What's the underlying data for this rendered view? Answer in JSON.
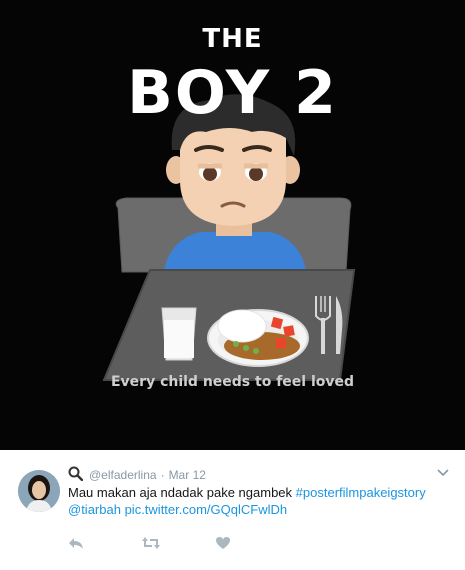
{
  "poster": {
    "title_line1": "THE",
    "title_line2": "BOY 2",
    "tagline": "Every child needs to feel loved"
  },
  "tweet": {
    "handle": "@elfaderlina",
    "separator": "·",
    "date": "Mar 12",
    "text_plain": "Mau makan aja ndadak pake ngambek ",
    "hashtag": "#posterfilmpakeigstory",
    "mention": "@tiarbah",
    "pic_link": "pic.twitter.com/GQqlCFwlDh"
  },
  "icons": {
    "verified_like": "magnifier-icon",
    "more": "chevron-down-icon",
    "reply": "reply-icon",
    "retweet": "retweet-icon",
    "like": "heart-icon"
  },
  "colors": {
    "link": "#1b95e0",
    "meta": "#8899a6",
    "text": "#14171a",
    "poster_bg": "#050505"
  }
}
